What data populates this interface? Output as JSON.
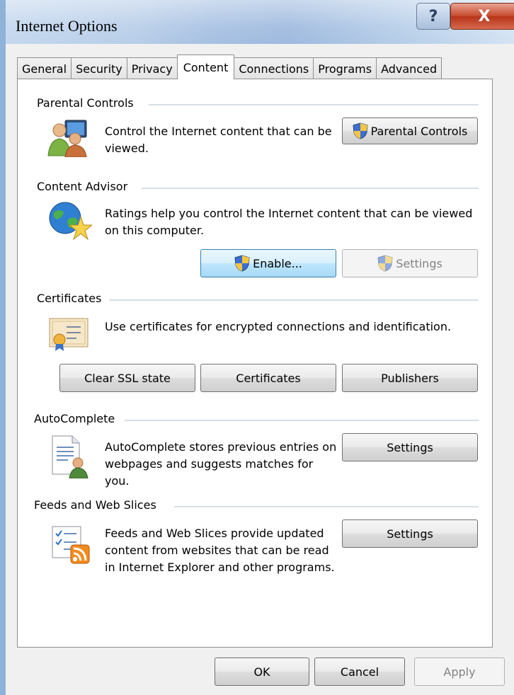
{
  "window": {
    "title": "Internet Options",
    "help_glyph": "?",
    "close_glyph": "X"
  },
  "tabs": [
    {
      "label": "General"
    },
    {
      "label": "Security"
    },
    {
      "label": "Privacy"
    },
    {
      "label": "Content",
      "active": true
    },
    {
      "label": "Connections"
    },
    {
      "label": "Programs"
    },
    {
      "label": "Advanced"
    }
  ],
  "parental": {
    "title": "Parental Controls",
    "desc": "Control the Internet content that can be viewed.",
    "button": "Parental Controls",
    "icon": "parental-users-icon"
  },
  "advisor": {
    "title": "Content Advisor",
    "desc": "Ratings help you control the Internet content that can be viewed on this computer.",
    "enable_button": "Enable...",
    "settings_button": "Settings",
    "icon": "globe-star-icon"
  },
  "certificates": {
    "title": "Certificates",
    "desc": "Use certificates for encrypted connections and identification.",
    "clear_ssl_button": "Clear SSL state",
    "certificates_button": "Certificates",
    "publishers_button": "Publishers",
    "icon": "certificate-icon"
  },
  "autocomplete": {
    "title": "AutoComplete",
    "desc": "AutoComplete stores previous entries on webpages and suggests matches for you.",
    "settings_button": "Settings",
    "icon": "autocomplete-icon"
  },
  "feeds": {
    "title": "Feeds and Web Slices",
    "desc": "Feeds and Web Slices provide updated content from websites that can be read in Internet Explorer and other programs.",
    "settings_button": "Settings",
    "icon": "rss-feed-icon"
  },
  "footer": {
    "ok": "OK",
    "cancel": "Cancel",
    "apply": "Apply"
  },
  "colors": {
    "accent": "#3c7fb1",
    "title_bar": "#b7cde8",
    "close_red": "#c6482c"
  }
}
